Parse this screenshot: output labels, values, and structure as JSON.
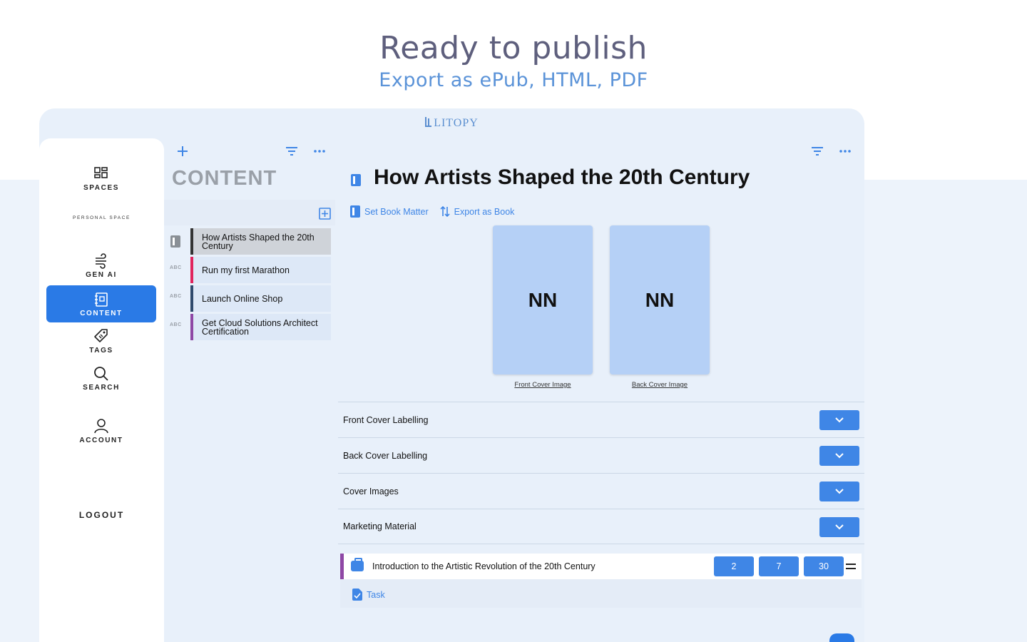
{
  "hero": {
    "title": "Ready to publish",
    "subtitle": "Export as ePub, HTML, PDF"
  },
  "app": {
    "brand": "LITOPY"
  },
  "nav": {
    "spaces": "SPACES",
    "personal_space": "PERSONAL SPACE",
    "gen_ai": "GEN AI",
    "content": "CONTENT",
    "tags": "TAGS",
    "search": "SEARCH",
    "account": "ACCOUNT",
    "logout": "LOGOUT"
  },
  "list": {
    "heading": "CONTENT",
    "items": [
      {
        "label": "How Artists Shaped the 20th Century",
        "type_icon": "book-icon",
        "accent": "#333333",
        "selected": true
      },
      {
        "label": "Run my first Marathon",
        "type_icon": "ABC",
        "accent": "#e0245e",
        "selected": false
      },
      {
        "label": "Launch Online Shop",
        "type_icon": "ABC",
        "accent": "#2f4a6d",
        "selected": false
      },
      {
        "label": "Get Cloud Solutions Architect Certification",
        "type_icon": "ABC",
        "accent": "#8e47a5",
        "selected": false
      }
    ]
  },
  "document": {
    "title": "How Artists Shaped the 20th Century",
    "actions": {
      "set_book_matter": "Set Book Matter",
      "export_as_book": "Export as Book"
    },
    "covers": [
      {
        "placeholder": "NN",
        "caption": "Front Cover Image"
      },
      {
        "placeholder": "NN",
        "caption": "Back Cover Image"
      }
    ],
    "sections": [
      "Front Cover Labelling",
      "Back Cover Labelling",
      "Cover Images",
      "Marketing Material"
    ],
    "task": {
      "title": "Introduction to the Artistic Revolution of the 20th Century",
      "counts": [
        "2",
        "7",
        "30"
      ],
      "accent": "#8e47a5",
      "sub_label": "Task"
    }
  },
  "colors": {
    "accent": "#3f86e6",
    "nav_active": "#2a7ae6",
    "hero_title": "#5e5f7d",
    "hero_subtitle": "#5b93d8"
  }
}
